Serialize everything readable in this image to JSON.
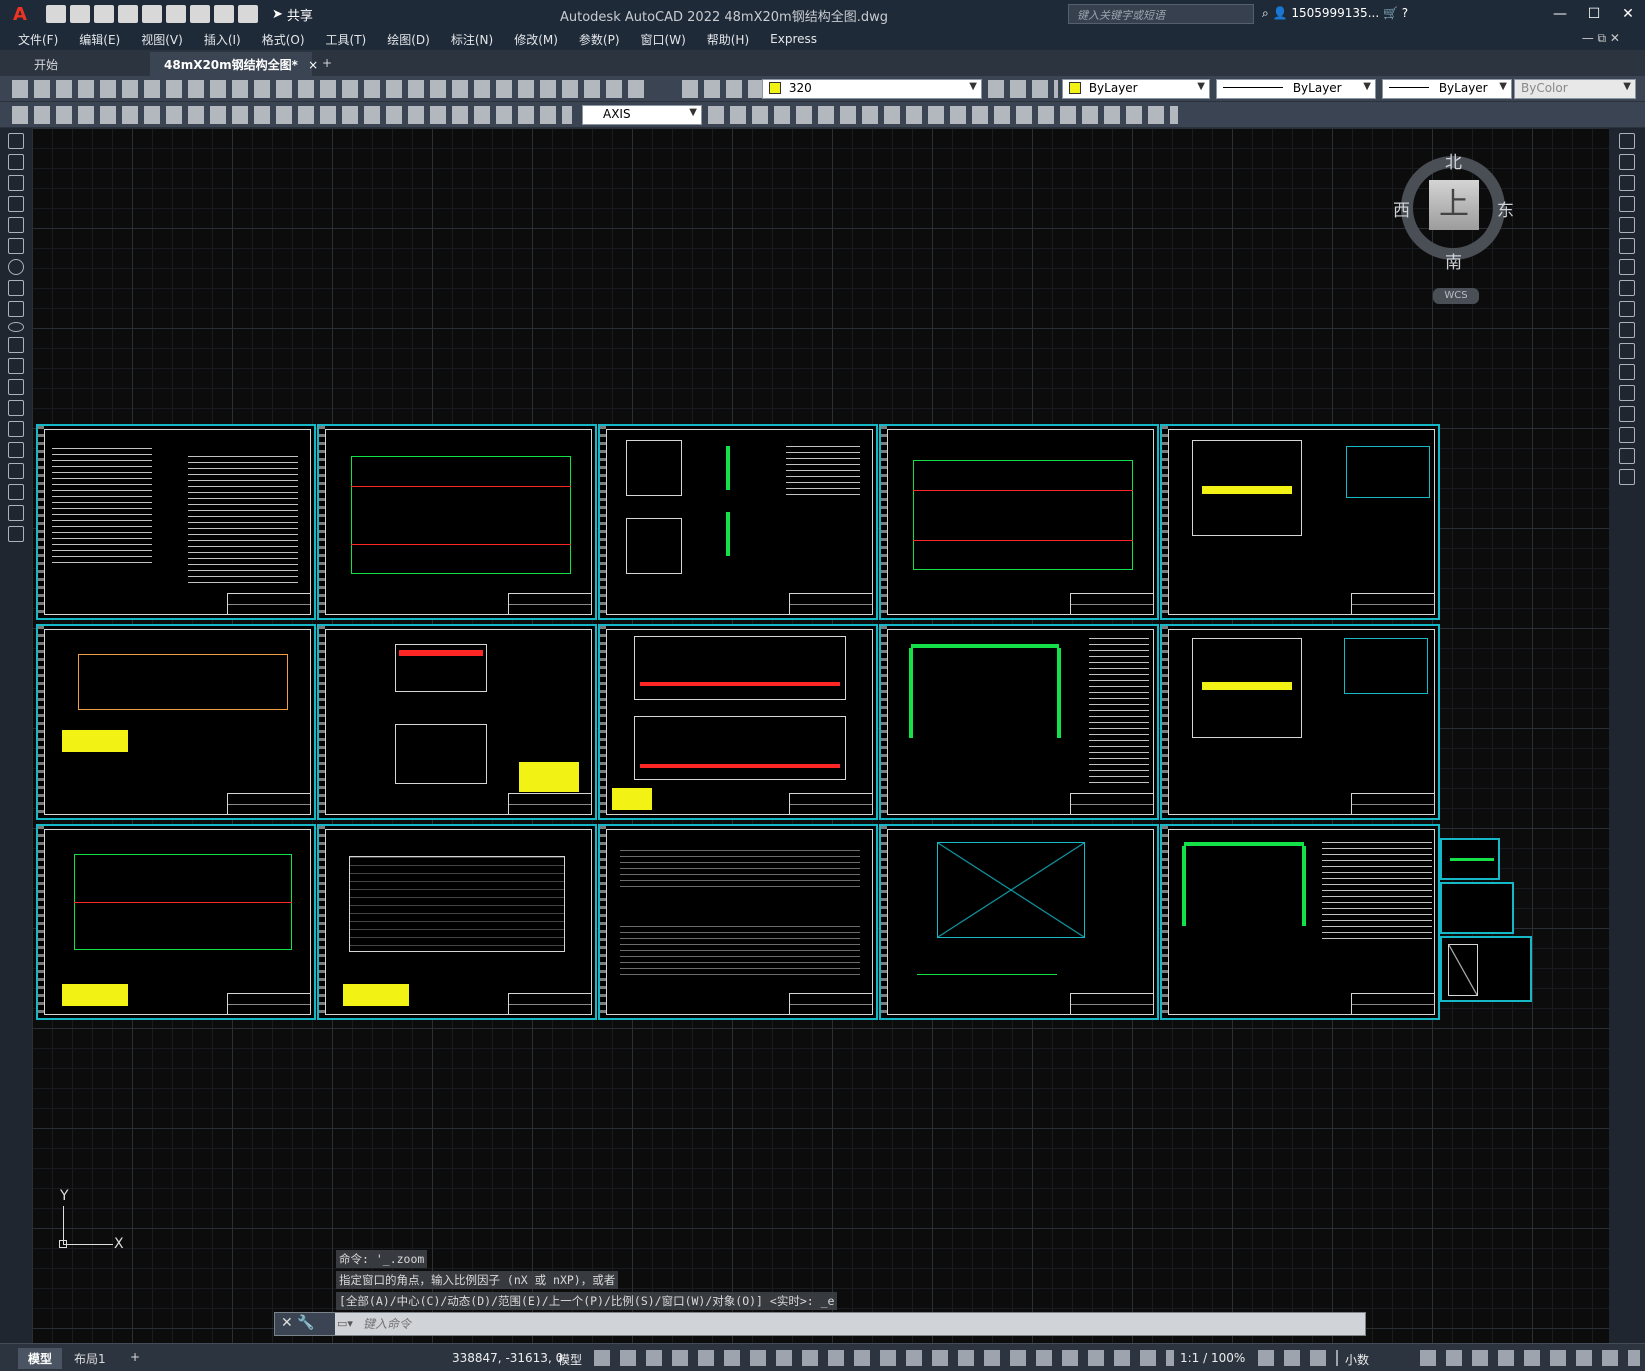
{
  "app": {
    "logo": "A",
    "title": "Autodesk AutoCAD 2022    48mX20m钢结构全图.dwg",
    "share_label": "共享",
    "search_placeholder": "键入关键字或短语",
    "user": "1505999135...",
    "window_controls": [
      "—",
      "☐",
      "✕"
    ]
  },
  "menu": [
    "文件(F)",
    "编辑(E)",
    "视图(V)",
    "插入(I)",
    "格式(O)",
    "工具(T)",
    "绘图(D)",
    "标注(N)",
    "修改(M)",
    "参数(P)",
    "窗口(W)",
    "帮助(H)",
    "Express"
  ],
  "menu_right": "— ⧉ ✕",
  "tabs": {
    "start": "开始",
    "drawing": "48mX20m钢结构全图*",
    "close": "×",
    "plus": "+"
  },
  "toolbar": {
    "layer_value": "320",
    "layer_color": "#f2f214",
    "color_value": "ByLayer",
    "linetype_value": "ByLayer",
    "lineweight_value": "ByLayer",
    "plotstyle_value": "ByColor",
    "textstyle_value": "AXIS"
  },
  "viewcube": {
    "top": "上",
    "north": "北",
    "south": "南",
    "east": "东",
    "west": "西",
    "wcs": "WCS"
  },
  "ucs": {
    "x": "X",
    "y": "Y"
  },
  "command": {
    "history": [
      "命令: '_.zoom",
      "指定窗口的角点，输入比例因子 (nX 或 nXP)，或者",
      "[全部(A)/中心(C)/动态(D)/范围(E)/上一个(P)/比例(S)/窗口(W)/对象(O)] <实时>: _e"
    ],
    "placeholder": "键入命令",
    "left_buttons": "✕  🔧"
  },
  "status": {
    "layout_tabs": [
      "模型",
      "布局1"
    ],
    "plus": "+",
    "coords": "338847, -31613, 0",
    "model_label": "模型",
    "scale": "1:1 / 100%",
    "units": "小数"
  },
  "colors": {
    "sheet_border": "#14b8c6",
    "plan_green": "#14e048",
    "plan_red": "#ff2626",
    "table_yellow": "#f2f214"
  }
}
